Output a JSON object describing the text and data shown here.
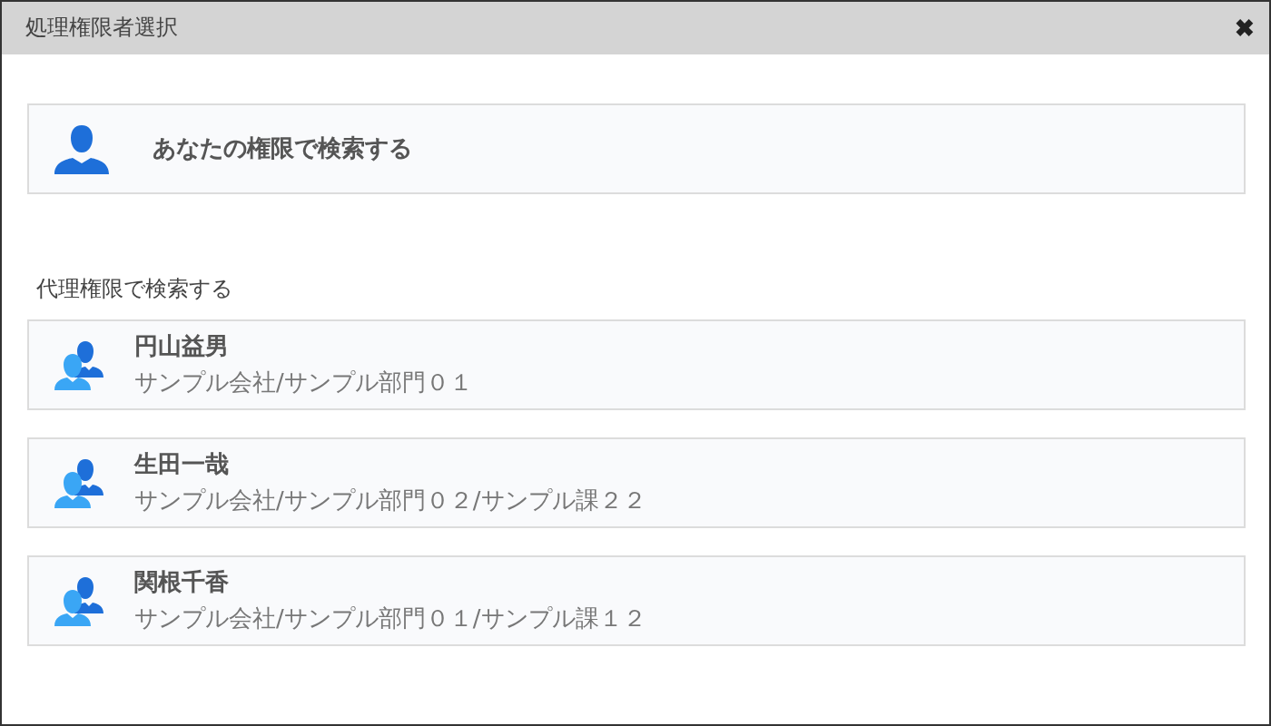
{
  "window": {
    "title": "処理権限者選択",
    "close": "✖"
  },
  "own_search": {
    "label": "あなたの権限で検索する"
  },
  "proxy_section": {
    "label": "代理権限で検索する"
  },
  "proxies": [
    {
      "name": "円山益男",
      "org": "サンプル会社/サンプル部門０１"
    },
    {
      "name": "生田一哉",
      "org": "サンプル会社/サンプル部門０２/サンプル課２２"
    },
    {
      "name": "関根千香",
      "org": "サンプル会社/サンプル部門０１/サンプル課１２"
    }
  ]
}
